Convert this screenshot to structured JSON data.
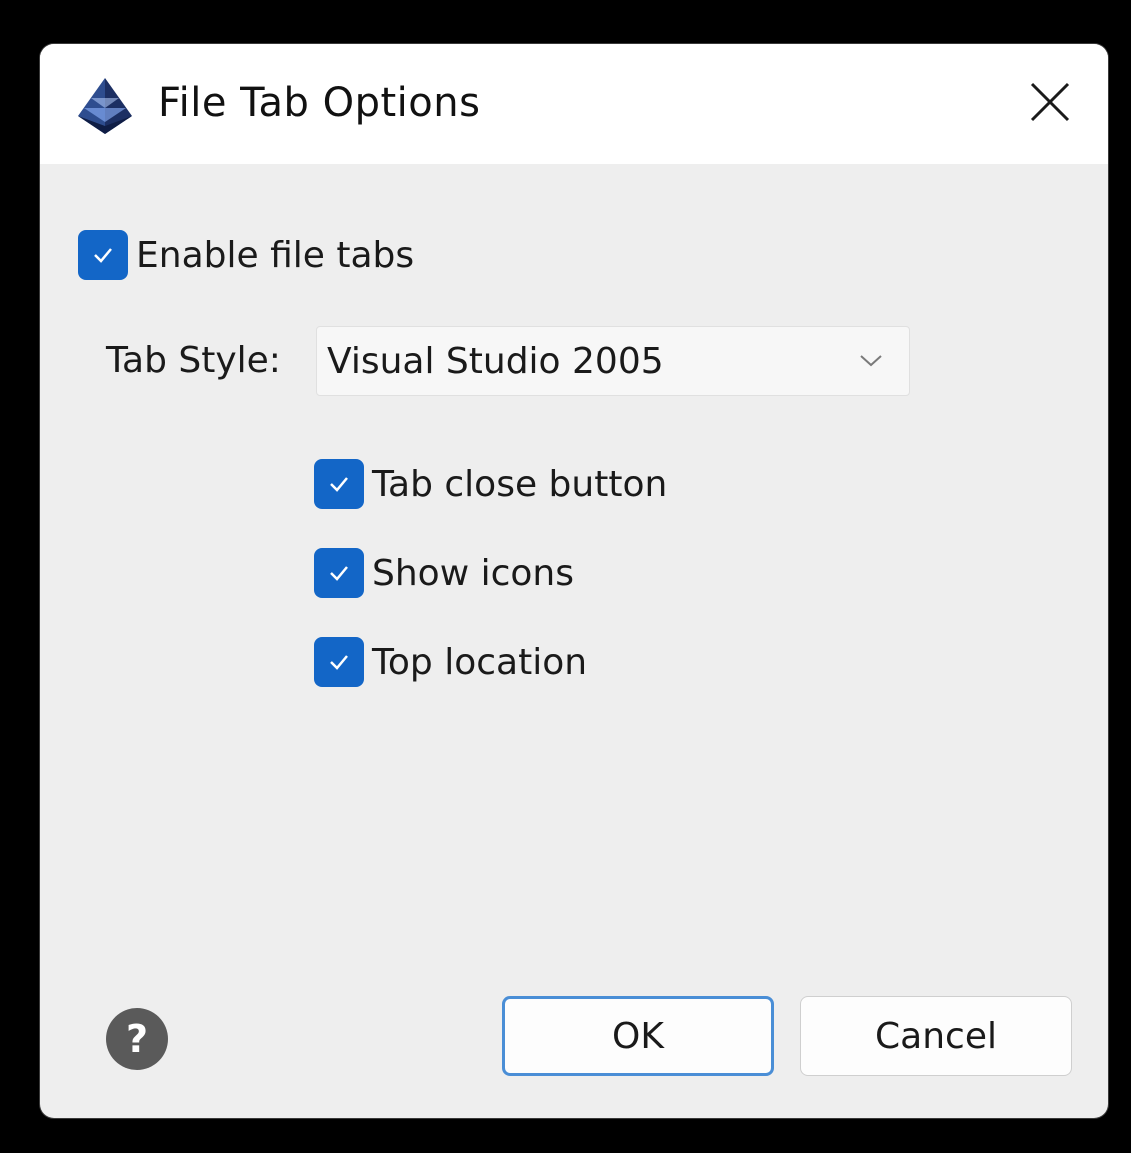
{
  "window": {
    "title": "File Tab Options",
    "app_icon": "pyramid-app-icon",
    "close_icon": "close-icon"
  },
  "options": {
    "enable_file_tabs": {
      "label": "Enable file tabs",
      "checked": true
    },
    "tab_style": {
      "label": "Tab Style:",
      "value": "Visual Studio 2005"
    },
    "tab_close_button": {
      "label": "Tab close button",
      "checked": true
    },
    "show_icons": {
      "label": "Show icons",
      "checked": true
    },
    "top_location": {
      "label": "Top location",
      "checked": true
    }
  },
  "footer": {
    "help_icon": "help-icon",
    "ok_label": "OK",
    "cancel_label": "Cancel"
  },
  "colors": {
    "accent": "#1366c7",
    "dialog_bg": "#eeeeee",
    "titlebar_bg": "#ffffff",
    "ok_border": "#4a8ed6"
  }
}
